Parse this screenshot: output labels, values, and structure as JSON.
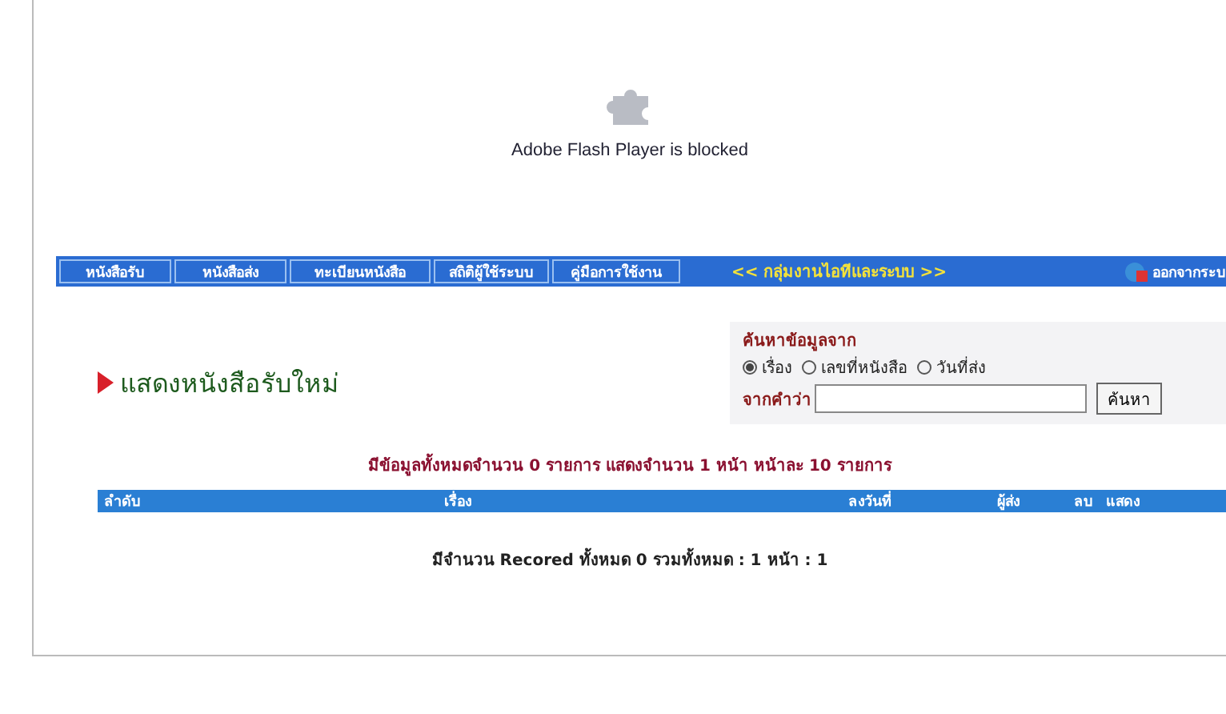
{
  "plugin_notice": {
    "message": "Adobe Flash Player is blocked"
  },
  "nav": {
    "items": [
      {
        "label": "หนังสือรับ"
      },
      {
        "label": "หนังสือส่ง"
      },
      {
        "label": "ทะเบียนหนังสือ"
      },
      {
        "label": "สถิติผู้ใช้ระบบ"
      },
      {
        "label": "คู่มือการใช้งาน"
      }
    ],
    "group_title": "<< กลุ่มงานไอทีและระบบ >>",
    "logout": "ออกจากระบ"
  },
  "heading": "แสดงหนังสือรับใหม่",
  "search": {
    "title": "ค้นหาข้อมูลจาก",
    "options": [
      {
        "label": "เรื่อง",
        "selected": true
      },
      {
        "label": "เลขที่หนังสือ",
        "selected": false
      },
      {
        "label": "วันที่ส่ง",
        "selected": false
      }
    ],
    "keyword_label": "จากคำว่า",
    "button": "ค้นหา"
  },
  "summary": "มีข้อมูลทั้งหมดจำนวน 0 รายการ แสดงจำนวน 1 หน้า หน้าละ 10 รายการ",
  "table": {
    "columns": [
      "ลำดับ",
      "เรื่อง",
      "ลงวันที่",
      "ผู้ส่ง",
      "ลบ",
      "แสดง"
    ]
  },
  "footer": "มีจำนวน Recored ทั้งหมด 0 รวมทั้งหมด : 1 หน้า : 1"
}
